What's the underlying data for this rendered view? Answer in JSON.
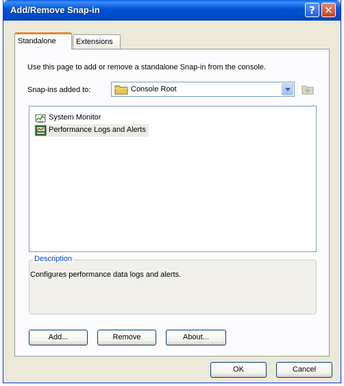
{
  "window": {
    "title": "Add/Remove Snap-in",
    "help_label": "?",
    "close_label": "✕"
  },
  "tabs": [
    {
      "label": "Standalone",
      "active": true
    },
    {
      "label": "Extensions",
      "active": false
    }
  ],
  "standalone": {
    "instruction": "Use this page to add or remove a standalone Snap-in from the console.",
    "added_to_label": "Snap-ins added to:",
    "added_to_value": "Console Root",
    "snapins": [
      {
        "label": "System Monitor",
        "icon": "system-monitor-icon"
      },
      {
        "label": "Performance Logs and Alerts",
        "icon": "performance-logs-icon"
      }
    ],
    "description_title": "Description",
    "description_text": "Configures performance data logs and alerts.",
    "buttons": {
      "add": "Add...",
      "remove": "Remove",
      "about": "About..."
    }
  },
  "footer": {
    "ok": "OK",
    "cancel": "Cancel"
  },
  "colors": {
    "titlebar": "#0052d6",
    "dialog_bg": "#ece9d8",
    "active_tab_accent": "#e68b2c",
    "group_title": "#0046d5"
  }
}
